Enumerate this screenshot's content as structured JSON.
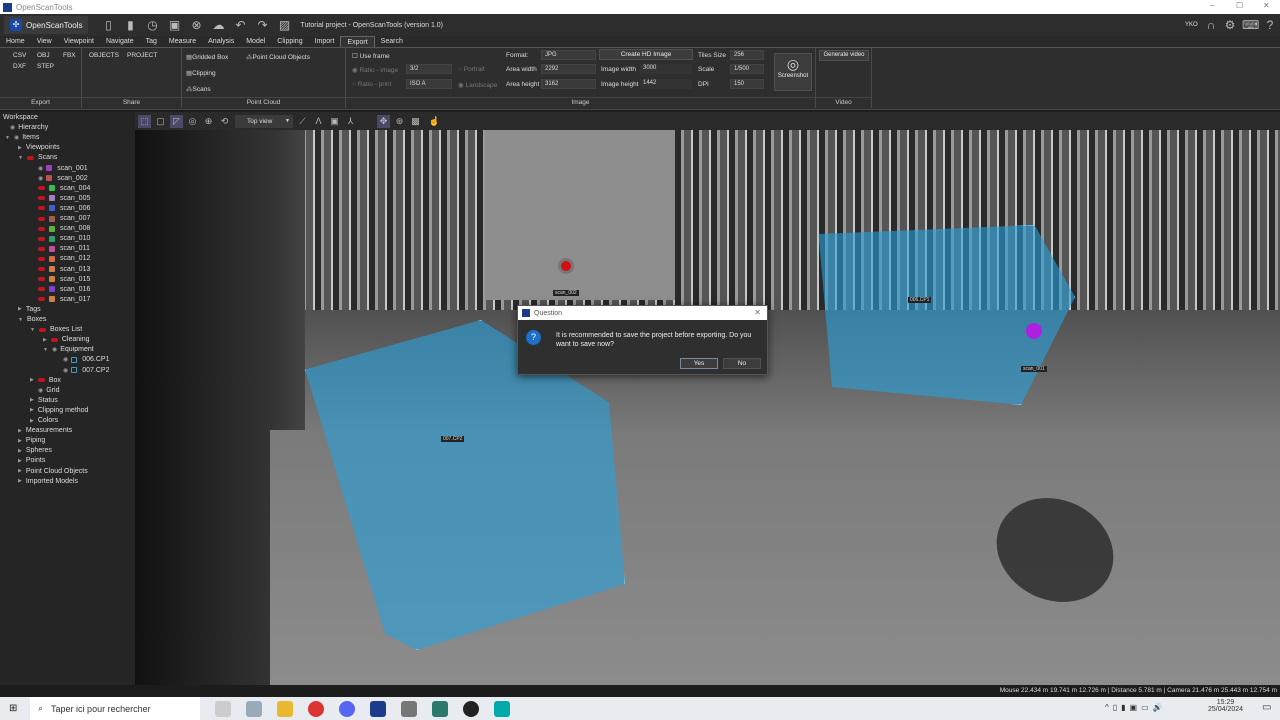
{
  "window": {
    "title": "OpenScanTools",
    "min": "–",
    "max": "☐",
    "close": "✕"
  },
  "app": {
    "brand": "OpenScanTools",
    "project_title": "Tutorial project - OpenScanTools (version 1.0)",
    "user": "YKO"
  },
  "tabs": [
    "Home",
    "View",
    "Viewpoint",
    "Navigate",
    "Tag",
    "Measure",
    "Analysis",
    "Model",
    "Clipping",
    "Import",
    "Export",
    "Search"
  ],
  "active_tab": "Export",
  "ribbon": {
    "export": {
      "items": [
        "CSV",
        "OBJ",
        "FBX",
        "DXF",
        "STEP"
      ],
      "label": "Export"
    },
    "share": {
      "items": [
        "OBJECTS",
        "PROJECT"
      ],
      "label": "Share"
    },
    "pointcloud": {
      "items": [
        "Gridded Box",
        "Point Cloud Objects",
        "Clipping",
        "Scans"
      ],
      "label": "Point Cloud"
    },
    "image": {
      "use_frame": "Use frame",
      "ratio_image": "Ratio - image",
      "ratio_image_val": "3/2",
      "ratio_print": "Ratio - print",
      "ratio_print_val": "ISO A",
      "portrait": "Portrait",
      "landscape": "Landscape",
      "format_label": "Format:",
      "format": "JPG",
      "area_width_label": "Area width",
      "area_width": "2292",
      "area_height_label": "Area  height",
      "area_height": "3162",
      "create_hd": "Create HD Image",
      "image_width_label": "Image width",
      "image_width": "3000",
      "image_height_label": "Image height",
      "image_height": "1442",
      "tiles_label": "Tiles Size",
      "tiles": "256",
      "scale_label": "Scale",
      "scale": "1/500",
      "dpi_label": "DPI",
      "dpi": "150",
      "screenshot": "Screenshot",
      "label": "Image"
    },
    "video": {
      "generate": "Generate video",
      "label": "Video"
    }
  },
  "tree": {
    "workspace": "Workspace",
    "hierarchy": "Hierarchy",
    "items": "Items",
    "viewpoints": "Viewpoints",
    "scans": "Scans",
    "scan_list": [
      "scan_001",
      "scan_002",
      "scan_004",
      "scan_005",
      "scan_006",
      "scan_007",
      "scan_008",
      "scan_010",
      "scan_011",
      "scan_012",
      "scan_013",
      "scan_015",
      "scan_016",
      "scan_017"
    ],
    "scan_colors": [
      "#a040c0",
      "#c05050",
      "#30c050",
      "#a080c0",
      "#4060d0",
      "#a06050",
      "#60b040",
      "#30a070",
      "#c050a0",
      "#d07040",
      "#d08050",
      "#d08040",
      "#8040d0",
      "#d08040"
    ],
    "tags": "Tags",
    "boxes": "Boxes",
    "boxes_list": "Boxes List",
    "cleaning": "Cleaning",
    "equipment": "Equipment",
    "box1": "006.CP1",
    "box2": "007.CP2",
    "box": "Box",
    "grid": "Grid",
    "status": "Status",
    "clipping_method": "Clipping method",
    "colors": "Colors",
    "others": [
      "Measurements",
      "Piping",
      "Spheres",
      "Points",
      "Point Cloud Objects",
      "Imported Models"
    ]
  },
  "viewtb": {
    "view_select": "Top view"
  },
  "scene": {
    "labels": {
      "scan_002": "scan_002",
      "box1": "006.CP1",
      "box2": "007.CP2",
      "scan_001": "scan_001"
    }
  },
  "dialog": {
    "title": "Question",
    "message": "It is recommended to save the project before exporting. Do you want to save now?",
    "yes": "Yes",
    "no": "No"
  },
  "statusbar": "Mouse 22.434 m 19.741 m 12.726 m | Distance 5.781 m |  Camera 21.476 m 25.443 m 12.754 m",
  "taskbar": {
    "search_placeholder": "Taper ici pour rechercher",
    "time": "15:29",
    "date": "25/04/2024"
  }
}
